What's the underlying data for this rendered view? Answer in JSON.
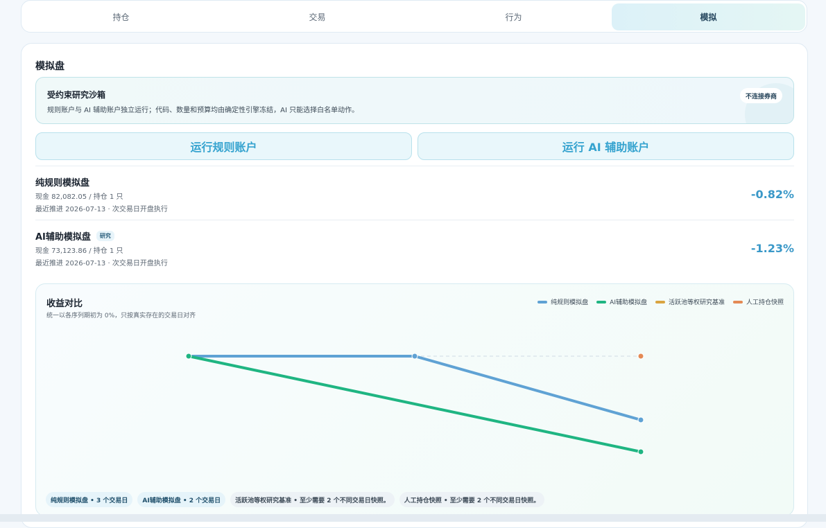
{
  "tabs": [
    {
      "label": "持仓",
      "active": false
    },
    {
      "label": "交易",
      "active": false
    },
    {
      "label": "行为",
      "active": false
    },
    {
      "label": "模拟",
      "active": true
    }
  ],
  "section": {
    "title": "模拟盘"
  },
  "sandbox": {
    "title": "受约束研究沙箱",
    "description": "规则账户与 AI 辅助账户独立运行；代码、数量和预算均由确定性引擎冻结，AI 只能选择白名单动作。",
    "badge": "不连接券商"
  },
  "buttons": {
    "run_rule": "运行规则账户",
    "run_ai": "运行 AI 辅助账户"
  },
  "accounts": [
    {
      "name": "纯规则模拟盘",
      "tag": "",
      "line1": "现金 82,082.05 / 持仓 1 只",
      "line2": "最近推进 2026-07-13 · 次交易日开盘执行",
      "return": "-0.82%"
    },
    {
      "name": "AI辅助模拟盘",
      "tag": "研究",
      "line1": "现金 73,123.86 / 持仓 1 只",
      "line2": "最近推进 2026-07-13 · 次交易日开盘执行",
      "return": "-1.23%"
    }
  ],
  "chart": {
    "title": "收益对比",
    "subtitle": "统一以各序列期初为 0%，只按真实存在的交易日对齐",
    "legend": [
      {
        "name": "纯规则模拟盘",
        "color": "#5fa2d4"
      },
      {
        "name": "AI辅助模拟盘",
        "color": "#1fb582"
      },
      {
        "name": "活跃池等权研究基准",
        "color": "#d9a441"
      },
      {
        "name": "人工持仓快照",
        "color": "#e48a55"
      }
    ],
    "chips": [
      {
        "text": "纯规则模拟盘 • 3 个交易日",
        "muted": false
      },
      {
        "text": "AI辅助模拟盘 • 2 个交易日",
        "muted": false
      },
      {
        "text": "活跃池等权研究基准 • 至少需要 2 个不同交易日快照。",
        "muted": true
      },
      {
        "text": "人工持仓快照 • 至少需要 2 个不同交易日快照。",
        "muted": true
      }
    ]
  },
  "chart_data": {
    "type": "line",
    "x": [
      0,
      1,
      2
    ],
    "series": [
      {
        "name": "纯规则模拟盘",
        "color": "#5fa2d4",
        "points": [
          [
            0,
            0
          ],
          [
            1,
            0
          ],
          [
            2,
            -0.82
          ]
        ]
      },
      {
        "name": "AI辅助模拟盘",
        "color": "#1fb582",
        "points": [
          [
            0,
            0
          ],
          [
            2,
            -1.23
          ]
        ]
      },
      {
        "name": "人工持仓快照",
        "color": "#e48a55",
        "points": [
          [
            2,
            0
          ]
        ]
      }
    ],
    "ylim": [
      -1.5,
      0.5
    ],
    "grid": false,
    "legend_position": "top-right"
  }
}
